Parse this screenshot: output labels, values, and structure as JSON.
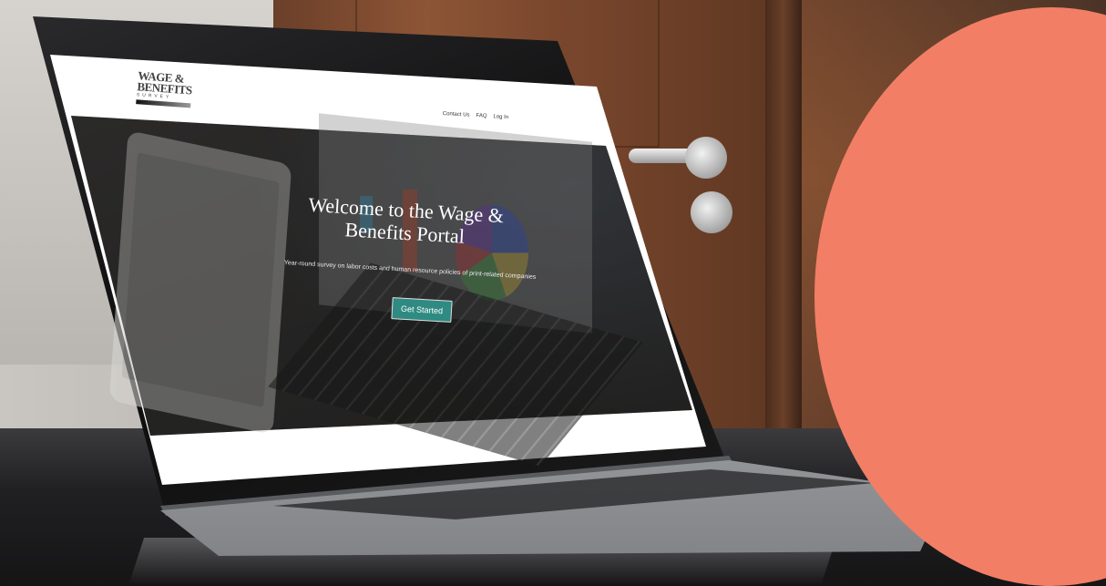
{
  "site": {
    "logo": {
      "line1": "WAGE &",
      "line2": "BENEFITS",
      "line3": "SURVEY"
    },
    "nav": [
      {
        "label": "Contact Us"
      },
      {
        "label": "FAQ"
      },
      {
        "label": "Log In"
      }
    ],
    "hero": {
      "title": "Welcome to the Wage & Benefits Portal",
      "subtitle": "Year-round survey on labor costs and human resource policies of print-related companies",
      "cta_label": "Get Started"
    }
  },
  "colors": {
    "accent": "#2f8a82",
    "decor_circle": "#f27e66"
  }
}
